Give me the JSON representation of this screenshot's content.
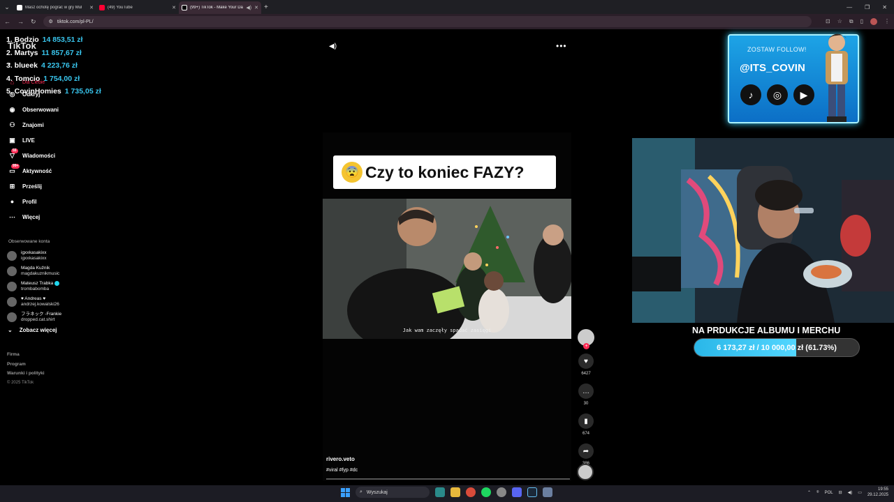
{
  "browser": {
    "tabs": [
      {
        "title": "Masz ochotę pograć w gry Mul",
        "favicon_color": "#ffffff",
        "active": false
      },
      {
        "title": "(49) YouTube",
        "favicon_color": "#ff0033",
        "active": false
      },
      {
        "title": "(99+) TikTok - Make Your Da",
        "favicon_color": "#ffffff",
        "active": true
      }
    ],
    "new_tab": "+",
    "url": "tiktok.com/pl-PL/"
  },
  "leaderboard": [
    {
      "name": "1. Bodzio",
      "amount": "14 853,51 zł"
    },
    {
      "name": "2. Martys",
      "amount": "11 857,67 zł"
    },
    {
      "name": "3. blueek",
      "amount": "4 223,76 zł"
    },
    {
      "name": "4. Tomcio",
      "amount": "1 754,00 zł"
    },
    {
      "name": "5. CovinHomies",
      "amount": "1 735,05 zł"
    }
  ],
  "tiktok": {
    "logo": "TikTok",
    "nav": {
      "home": "Dla Ciebie",
      "items": [
        {
          "label": "Odkryj",
          "icon": "compass-icon",
          "glyph": "◎",
          "badge": ""
        },
        {
          "label": "Obserwowani",
          "icon": "following-icon",
          "glyph": "◉",
          "badge": ""
        },
        {
          "label": "Znajomi",
          "icon": "friends-icon",
          "glyph": "⚇",
          "badge": ""
        },
        {
          "label": "LIVE",
          "icon": "live-icon",
          "glyph": "▣",
          "badge": ""
        },
        {
          "label": "Wiadomości",
          "icon": "messages-icon",
          "glyph": "▽",
          "badge": "55"
        },
        {
          "label": "Aktywność",
          "icon": "activity-icon",
          "glyph": "▭",
          "badge": "99+"
        },
        {
          "label": "Prześlij",
          "icon": "upload-icon",
          "glyph": "⊞",
          "badge": ""
        },
        {
          "label": "Profil",
          "icon": "profile-icon",
          "glyph": "●",
          "badge": ""
        },
        {
          "label": "Więcej",
          "icon": "more-icon",
          "glyph": "⋯",
          "badge": ""
        }
      ]
    },
    "followed_title": "Obserwowane konta",
    "followed": [
      {
        "name": "igxxkasakixx",
        "handle": "igxxkasakixx",
        "verified": false
      },
      {
        "name": "Magda Kuźnik",
        "handle": "magdakuznikmusic",
        "verified": false
      },
      {
        "name": "Mateusz Trabka",
        "handle": "trombabomba",
        "verified": true
      },
      {
        "name": "♥ Andreas ♥",
        "handle": "andrzej.kowalski26",
        "verified": false
      },
      {
        "name": "フラネック -Frankie",
        "handle": "dropped.cat.shirt",
        "verified": false
      }
    ],
    "see_more": "Zobacz więcej",
    "footer": [
      "Firma",
      "Program",
      "Warunki i polityki"
    ],
    "copyright": "© 2025 TikTok"
  },
  "video": {
    "caption": "Czy to koniec FAZY?",
    "caption_emoji": "😨",
    "subtitle": "Jak wam zaczęły spadać zasięgi",
    "author": "rivero.veto",
    "tags": "#viral #fyp #dc",
    "actions": [
      {
        "icon": "heart-icon",
        "glyph": "♥",
        "count": "6427"
      },
      {
        "icon": "comment-icon",
        "glyph": "…",
        "count": "30"
      },
      {
        "icon": "bookmark-icon",
        "glyph": "▮",
        "count": "674"
      },
      {
        "icon": "share-icon",
        "glyph": "➦",
        "count": "386"
      }
    ]
  },
  "follow_overlay": {
    "top_text": "ZOSTAW FOLLOW!",
    "handle": "@ITS_COVIN",
    "socials": [
      {
        "icon": "tiktok-icon",
        "glyph": "♪"
      },
      {
        "icon": "instagram-icon",
        "glyph": "◎"
      },
      {
        "icon": "youtube-icon",
        "glyph": "▶"
      }
    ]
  },
  "fundraiser": {
    "title": "NA PRDUKCJE ALBUMU I MERCHU",
    "progress_text": "6 173,27 zł / 10 000,00 zł (61.73%)",
    "progress": 0.6173
  },
  "taskbar": {
    "search_placeholder": "Wyszukaj",
    "language": "POL",
    "time": "19:55",
    "date": "29.12.2025"
  }
}
